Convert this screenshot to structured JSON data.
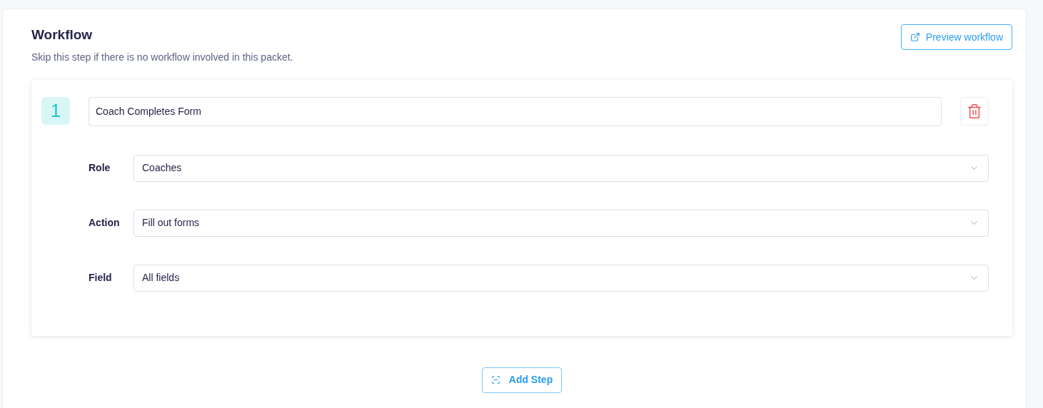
{
  "section": {
    "title": "Workflow",
    "description": "Skip this step if there is no workflow involved in this packet.",
    "preview_button": "Preview workflow"
  },
  "steps": [
    {
      "number": "1",
      "name": "Coach Completes Form",
      "fields": [
        {
          "label": "Role",
          "value": "Coaches"
        },
        {
          "label": "Action",
          "value": "Fill out forms"
        },
        {
          "label": "Field",
          "value": "All fields"
        }
      ]
    }
  ],
  "add_button": "Add Step"
}
